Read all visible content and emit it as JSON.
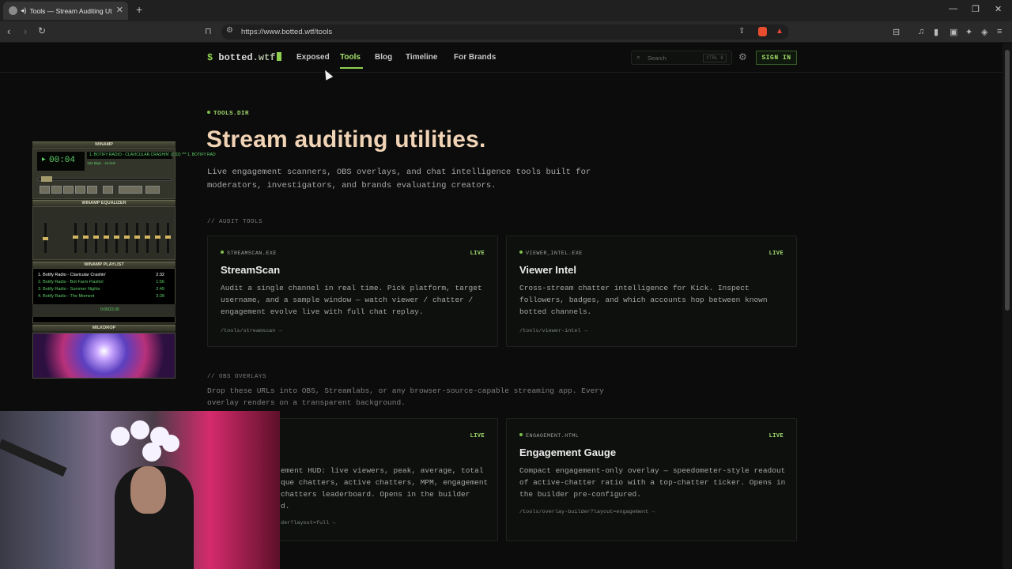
{
  "browser": {
    "tab_title": "Tools — Stream Auditing Utili",
    "url": "https://www.botted.wtf/tools"
  },
  "site": {
    "logo_prefix": "$",
    "logo_name": "botted",
    "logo_tld": ".wtf",
    "nav": [
      "Exposed",
      "Tools",
      "Blog",
      "Timeline",
      "For Brands"
    ],
    "active_nav": "Tools",
    "search_placeholder": "Search",
    "search_shortcut": "CTRL K",
    "signin_label": "SIGN IN"
  },
  "hero": {
    "eyebrow": "TOOLS.DIR",
    "title": "Stream auditing utilities.",
    "lead": "Live engagement scanners, OBS overlays, and chat intelligence tools built for moderators, investigators, and brands evaluating creators."
  },
  "audit_section": {
    "heading": "// AUDIT TOOLS",
    "cards": [
      {
        "key": "STREAMSCAN.EXE",
        "badge": "LIVE",
        "title": "StreamScan",
        "desc": "Audit a single channel in real time. Pick platform, target username, and a sample window — watch viewer / chatter / engagement evolve live with full chat replay.",
        "link": "/tools/streamscan →"
      },
      {
        "key": "VIEWER_INTEL.EXE",
        "badge": "LIVE",
        "title": "Viewer Intel",
        "desc": "Cross-stream chatter intelligence for Kick. Inspect followers, badges, and which accounts hop between known botted channels.",
        "link": "/tools/viewer-intel →"
      }
    ]
  },
  "overlay_section": {
    "heading": "// OBS OVERLAYS",
    "desc": "Drop these URLs into OBS, Streamlabs, or any browser-source-capable streaming app. Every overlay renders on a transparent background.",
    "cards": [
      {
        "badge": "LIVE",
        "desc_partial": "ement HUD: live viewers, peak, average, total\nque chatters, active chatters, MPM, engagement\nchatters leaderboard. Opens in the builder\nd.",
        "link_partial": "der?layout=full →"
      },
      {
        "key": "ENGAGEMENT.HTML",
        "badge": "LIVE",
        "title": "Engagement Gauge",
        "desc": "Compact engagement-only overlay — speedometer-style readout of active-chatter ratio with a top-chatter ticker. Opens in the builder pre-configured.",
        "link": "/tools/overlay-builder?layout=engagement →"
      }
    ]
  },
  "winamp": {
    "title": "WINAMP",
    "time": "00:04",
    "song_ticker": "1. BOTIFY RADIO - CLAVICULAR CRASHIN' (2:32) *** 1. BOTIFY RAD",
    "kbps": "192",
    "khz": "44",
    "eq_title": "WINAMP EQUALIZER",
    "playlist_title": "WINAMP PLAYLIST",
    "playlist": [
      {
        "n": "1. Botify Radio - Clavicular Crashin'",
        "d": "2:32"
      },
      {
        "n": "2. Botify Radio - Bot Farm Flashin'",
        "d": "1:56"
      },
      {
        "n": "3. Botify Radio - Summer Nights",
        "d": "2:49"
      },
      {
        "n": "4. Botify Radio - The Moment",
        "d": "3:28"
      }
    ],
    "playlist_time": "0:00/23:30",
    "milkdrop_title": "MILKDROP"
  }
}
